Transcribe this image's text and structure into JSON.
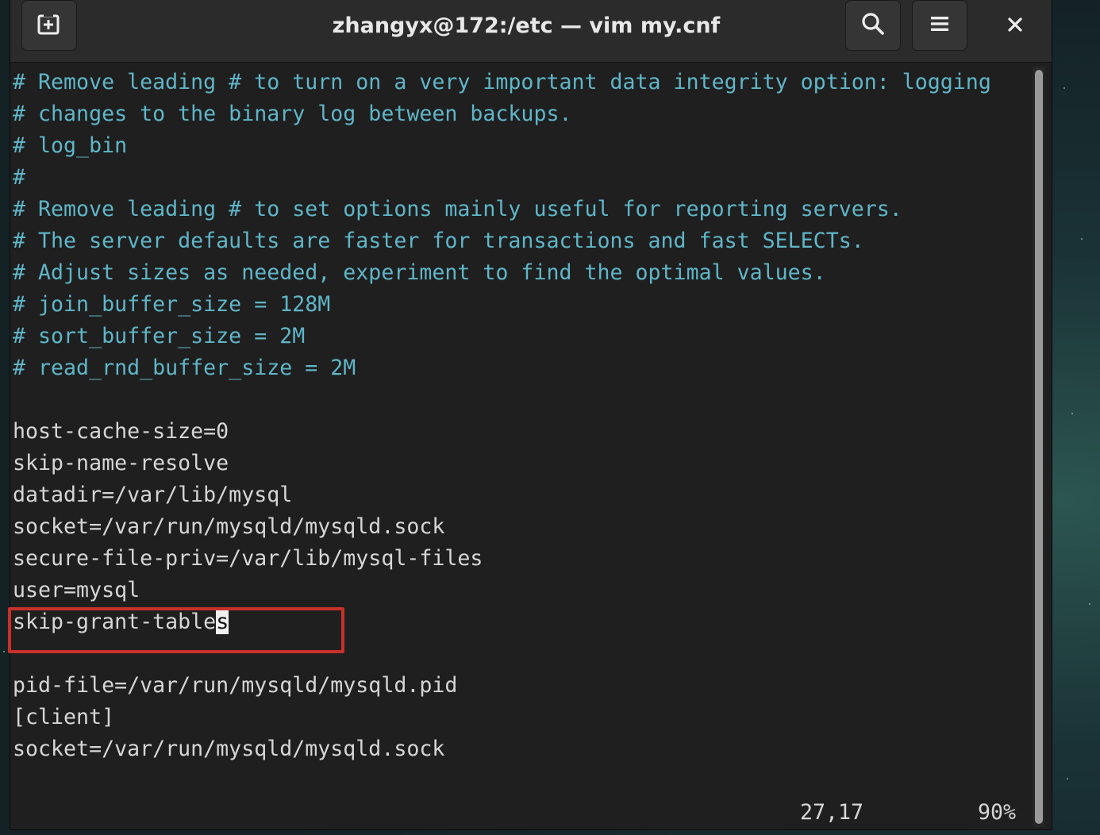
{
  "window": {
    "title": "zhangyx@172:/etc — vim my.cnf"
  },
  "icons": {
    "new_tab": "new-tab-icon",
    "search": "search-icon",
    "menu": "hamburger-menu-icon",
    "close": "close-icon"
  },
  "editor": {
    "lines": [
      "# Remove leading # to turn on a very important data integrity option: logging",
      "# changes to the binary log between backups.",
      "# log_bin",
      "#",
      "# Remove leading # to set options mainly useful for reporting servers.",
      "# The server defaults are faster for transactions and fast SELECTs.",
      "# Adjust sizes as needed, experiment to find the optimal values.",
      "# join_buffer_size = 128M",
      "# sort_buffer_size = 2M",
      "# read_rnd_buffer_size = 2M",
      "",
      "host-cache-size=0",
      "skip-name-resolve",
      "datadir=/var/lib/mysql",
      "socket=/var/run/mysqld/mysqld.sock",
      "secure-file-priv=/var/lib/mysql-files",
      "user=mysql",
      "",
      "",
      "pid-file=/var/run/mysqld/mysqld.pid",
      "[client]",
      "socket=/var/run/mysqld/mysqld.sock"
    ],
    "cursor_line_before": "skip-grant-table",
    "cursor_char": "s",
    "status_position": "27,17",
    "status_percent": "90%"
  },
  "colors": {
    "comment": "#5fb6c8",
    "text": "#d6d6d6",
    "highlight_box": "#c8302a"
  }
}
